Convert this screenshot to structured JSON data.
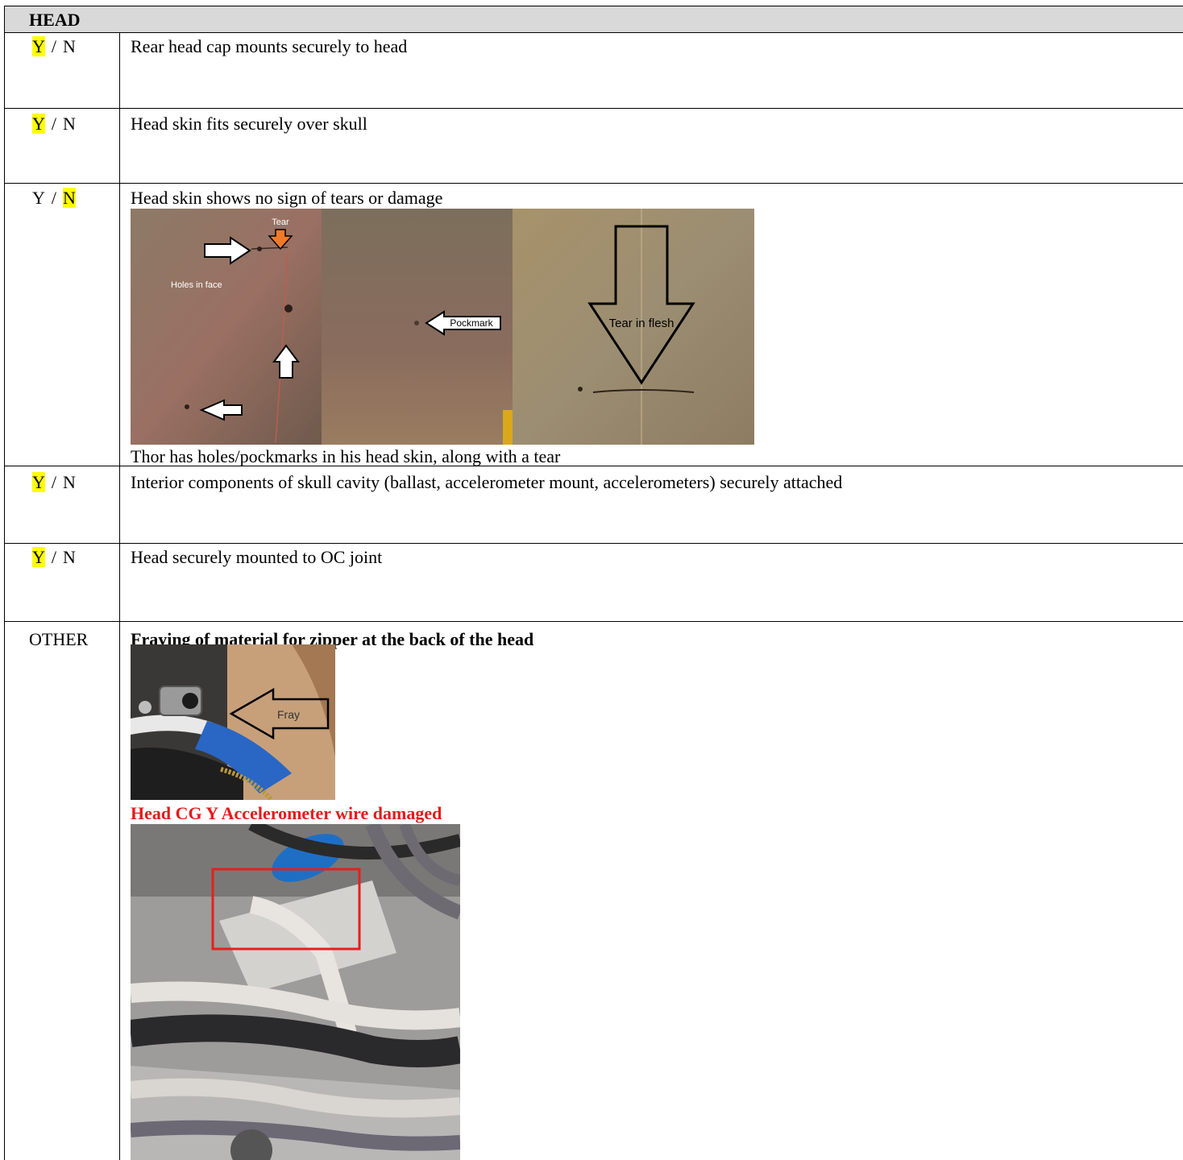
{
  "section_title": "HEAD",
  "choice": {
    "y": "Y",
    "n": "N",
    "sep": "/"
  },
  "rows": [
    {
      "text": "Rear head cap mounts securely to head",
      "selected": "Y"
    },
    {
      "text": "Head skin fits securely over skull",
      "selected": "Y"
    },
    {
      "text": "Head skin shows no sign of tears or damage",
      "selected": "N",
      "photo_labels": {
        "tear": "Tear",
        "holes": "Holes in face",
        "pockmark": "Pockmark",
        "tear_flesh": "Tear in flesh"
      },
      "caption": "Thor has holes/pockmarks in his head skin, along with a tear"
    },
    {
      "text": "Interior components of skull cavity (ballast, accelerometer mount, accelerometers) securely attached",
      "selected": "Y"
    },
    {
      "text": "Head securely mounted to OC joint",
      "selected": "Y"
    }
  ],
  "other": {
    "label": "OTHER",
    "note1": "Fraying of material for zipper at the back of the head",
    "fray_label": "Fray",
    "note2": "Head CG Y Accelerometer wire damaged"
  },
  "colors": {
    "highlight": "#ffff00",
    "note2": "#e31b1b",
    "header_bg": "#d9d9d9"
  }
}
